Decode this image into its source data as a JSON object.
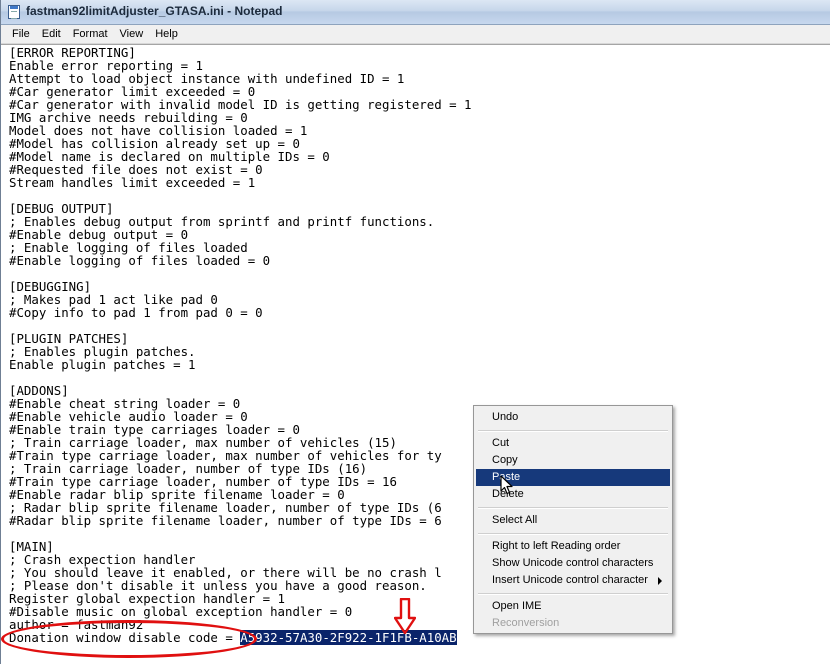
{
  "window": {
    "title": "fastman92limitAdjuster_GTASA.ini - Notepad"
  },
  "menubar": {
    "items": [
      "File",
      "Edit",
      "Format",
      "View",
      "Help"
    ]
  },
  "editor": {
    "lines": [
      "[ERROR REPORTING]",
      "Enable error reporting = 1",
      "Attempt to load object instance with undefined ID = 1",
      "#Car generator limit exceeded = 0",
      "#Car generator with invalid model ID is getting registered = 1",
      "IMG archive needs rebuilding = 0",
      "Model does not have collision loaded = 1",
      "#Model has collision already set up = 0",
      "#Model name is declared on multiple IDs = 0",
      "#Requested file does not exist = 0",
      "Stream handles limit exceeded = 1",
      "",
      "[DEBUG OUTPUT]",
      "; Enables debug output from sprintf and printf functions.",
      "#Enable debug output = 0",
      "; Enable logging of files loaded",
      "#Enable logging of files loaded = 0",
      "",
      "[DEBUGGING]",
      "; Makes pad 1 act like pad 0",
      "#Copy info to pad 1 from pad 0 = 0",
      "",
      "[PLUGIN PATCHES]",
      "; Enables plugin patches.",
      "Enable plugin patches = 1",
      "",
      "[ADDONS]",
      "#Enable cheat string loader = 0",
      "#Enable vehicle audio loader = 0",
      "#Enable train type carriages loader = 0",
      "; Train carriage loader, max number of vehicles (15)",
      "#Train type carriage loader, max number of vehicles for ty",
      "; Train carriage loader, number of type IDs (16)",
      "#Train type carriage loader, number of type IDs = 16",
      "#Enable radar blip sprite filename loader = 0",
      "; Radar blip sprite filename loader, number of type IDs (6",
      "#Radar blip sprite filename loader, number of type IDs = 6",
      "",
      "[MAIN]",
      "; Crash expection handler",
      "; You should leave it enabled, or there will be no crash l",
      "; Please don't disable it unless you have a good reason.",
      "Register global expection handler = 1",
      "#Disable music on global exception handler = 0",
      "author = fastman92"
    ],
    "last_line_prefix": "Donation window disable code = ",
    "last_line_selected": "A5932-57A30-2F922-1F1FB-A10AB"
  },
  "context_menu": {
    "undo": "Undo",
    "cut": "Cut",
    "copy": "Copy",
    "paste": "Paste",
    "delete": "Delete",
    "select_all": "Select All",
    "rtl": "Right to left Reading order",
    "show_unicode": "Show Unicode control characters",
    "insert_unicode": "Insert Unicode control character",
    "open_ime": "Open IME",
    "reconversion": "Reconversion",
    "highlighted": "Paste"
  },
  "colors": {
    "selection": "#0a246a",
    "menu_highlight": "#16397b",
    "annotation": "#e01010"
  },
  "icons": [
    "notepad-app-icon",
    "mouse-pointer-icon",
    "down-arrow-annotation",
    "ellipse-annotation"
  ]
}
